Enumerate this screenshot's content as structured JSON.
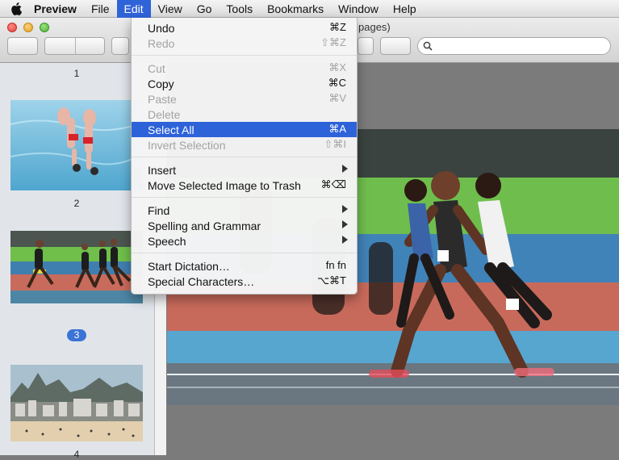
{
  "menubar": {
    "app": "Preview",
    "items": [
      "File",
      "Edit",
      "View",
      "Go",
      "Tools",
      "Bookmarks",
      "Window",
      "Help"
    ]
  },
  "window": {
    "title_fragment": "pages)",
    "search_placeholder": ""
  },
  "sidebar": {
    "thumbs": [
      {
        "label": "1"
      },
      {
        "label": "2"
      },
      {
        "label": "3",
        "selected": true
      },
      {
        "label": "4"
      }
    ]
  },
  "edit_menu": {
    "items": [
      {
        "label": "Undo",
        "shortcut": "⌘Z"
      },
      {
        "label": "Redo",
        "shortcut": "⇧⌘Z",
        "disabled": true
      },
      {
        "label": "Cut",
        "shortcut": "⌘X",
        "disabled": true
      },
      {
        "label": "Copy",
        "shortcut": "⌘C"
      },
      {
        "label": "Paste",
        "shortcut": "⌘V",
        "disabled": true
      },
      {
        "label": "Delete",
        "shortcut": "",
        "disabled": true
      },
      {
        "label": "Select All",
        "shortcut": "⌘A",
        "highlighted": true
      },
      {
        "label": "Invert Selection",
        "shortcut": "⇧⌘I",
        "disabled": true
      },
      {
        "label": "Insert",
        "submenu": true
      },
      {
        "label": "Move Selected Image to Trash",
        "shortcut": "⌘⌫"
      },
      {
        "label": "Find",
        "submenu": true
      },
      {
        "label": "Spelling and Grammar",
        "submenu": true
      },
      {
        "label": "Speech",
        "submenu": true
      },
      {
        "label": "Start Dictation…",
        "shortcut": "fn fn"
      },
      {
        "label": "Special Characters…",
        "shortcut": "⌥⌘T"
      }
    ]
  },
  "colors": {
    "menu_highlight": "#2d62d9",
    "selection_badge": "#3b73d6"
  }
}
